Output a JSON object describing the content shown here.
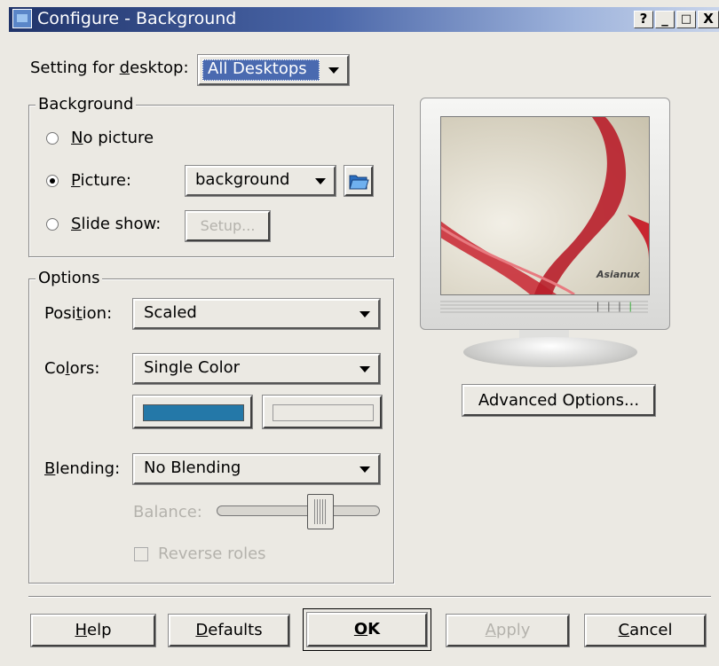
{
  "window": {
    "title": "Configure - Background",
    "buttons": {
      "help": "?",
      "minimize": "_",
      "maximize": "□",
      "close": "X"
    }
  },
  "desktop": {
    "label_pre": "Setting for ",
    "label_u": "d",
    "label_post": "esktop:",
    "value": "All Desktops"
  },
  "background": {
    "legend": "Background",
    "no_picture": {
      "u": "N",
      "rest": "o picture",
      "selected": false
    },
    "picture": {
      "u": "P",
      "rest": "icture:",
      "selected": true,
      "value": "background"
    },
    "slide_show": {
      "u": "S",
      "rest": "lide show:",
      "selected": false,
      "setup_u": "Setup...",
      "setup_label": "Setup..."
    }
  },
  "options": {
    "legend": "Options",
    "position": {
      "pre": "Posi",
      "u": "t",
      "post": "ion:",
      "value": "Scaled"
    },
    "colors": {
      "pre": "Co",
      "u": "l",
      "post": "ors:",
      "value": "Single Color",
      "color1": "#2478a8",
      "color2": "#ebe9e3"
    },
    "blending": {
      "u": "B",
      "rest": "lending:",
      "value": "No Blending"
    },
    "balance_label": "Balance:",
    "balance_value": 0.66,
    "reverse_roles": "Reverse roles"
  },
  "preview": {
    "brand": "Asianux",
    "advanced_button": "Advanced Options..."
  },
  "footer": {
    "help": {
      "u": "H",
      "rest": "elp"
    },
    "defaults": {
      "u": "D",
      "rest": "efaults"
    },
    "ok": {
      "u": "O",
      "rest": "K"
    },
    "apply": {
      "u": "A",
      "rest": "pply"
    },
    "cancel": {
      "u": "C",
      "rest": "ancel"
    }
  }
}
